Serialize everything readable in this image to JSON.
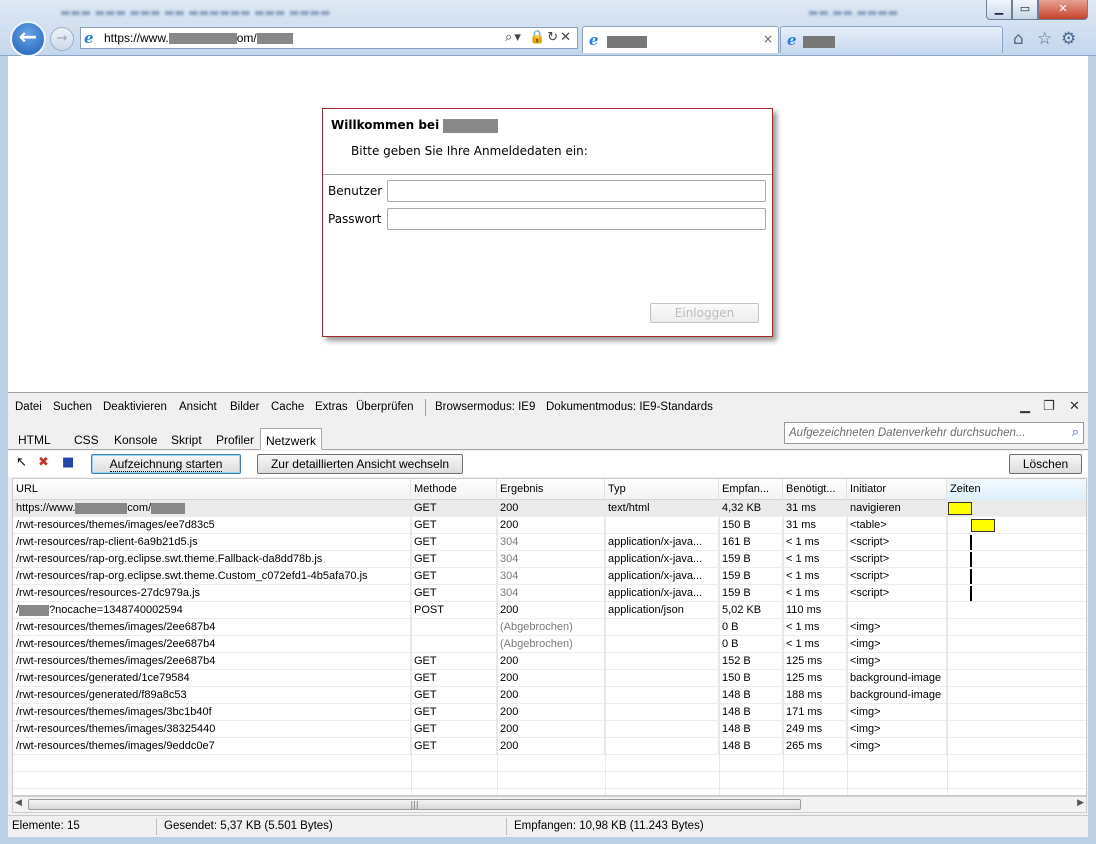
{
  "browser": {
    "url_prefix": "https://www.",
    "url_mid": "om/",
    "tab1_close": "×",
    "window_controls": {
      "minimize": "▁",
      "maximize": "▭",
      "close": "✕"
    }
  },
  "login": {
    "title": "Willkommen bei",
    "subtitle": "Bitte geben Sie Ihre Anmeldedaten ein:",
    "user_label": "Benutzer",
    "password_label": "Passwort",
    "user_value": "",
    "password_value": "",
    "submit_label": "Einloggen"
  },
  "devtools": {
    "menu": [
      "Datei",
      "Suchen",
      "Deaktivieren",
      "Ansicht",
      "Bilder",
      "Cache",
      "Extras",
      "Überprüfen"
    ],
    "browser_mode": "Browsermodus: IE9",
    "document_mode": "Dokumentmodus: IE9-Standards",
    "tabs": [
      "HTML",
      "CSS",
      "Konsole",
      "Skript",
      "Profiler",
      "Netzwerk"
    ],
    "active_tab": "Netzwerk",
    "search_placeholder": "Aufgezeichneten Datenverkehr durchsuchen...",
    "buttons": {
      "record": "Aufzeichnung starten",
      "detail": "Zur detaillierten Ansicht wechseln",
      "clear": "Löschen"
    },
    "columns": [
      "URL",
      "Methode",
      "Ergebnis",
      "Typ",
      "Empfan...",
      "Benötigt...",
      "Initiator",
      "Zeiten"
    ],
    "rows": [
      {
        "url_pre": "https://www.",
        "url_post": "com/",
        "redacted": true,
        "method": "GET",
        "result": "200",
        "type": "text/html",
        "received": "4,32 KB",
        "time": "31 ms",
        "initiator": "navigieren",
        "timing": "bar0",
        "selected": true
      },
      {
        "url": "/rwt-resources/themes/images/ee7d83c5",
        "method": "GET",
        "result": "200",
        "type": "",
        "received": "150 B",
        "time": "31 ms",
        "initiator": "<table>",
        "timing": "bar1"
      },
      {
        "url": "/rwt-resources/rap-client-6a9b21d5.js",
        "method": "GET",
        "result": "304",
        "type": "application/x-java...",
        "received": "161 B",
        "time": "< 1 ms",
        "initiator": "<script>",
        "timing": "tick"
      },
      {
        "url": "/rwt-resources/rap-org.eclipse.swt.theme.Fallback-da8dd78b.js",
        "method": "GET",
        "result": "304",
        "type": "application/x-java...",
        "received": "159 B",
        "time": "< 1 ms",
        "initiator": "<script>",
        "timing": "tick"
      },
      {
        "url": "/rwt-resources/rap-org.eclipse.swt.theme.Custom_c072efd1-4b5afa70.js",
        "method": "GET",
        "result": "304",
        "type": "application/x-java...",
        "received": "159 B",
        "time": "< 1 ms",
        "initiator": "<script>",
        "timing": "tick"
      },
      {
        "url": "/rwt-resources/resources-27dc979a.js",
        "method": "GET",
        "result": "304",
        "type": "application/x-java...",
        "received": "159 B",
        "time": "< 1 ms",
        "initiator": "<script>",
        "timing": "tick"
      },
      {
        "url_pre": "/",
        "url_post": "?nocache=1348740002594",
        "redacted": true,
        "method": "POST",
        "result": "200",
        "type": "application/json",
        "received": "5,02 KB",
        "time": "110 ms",
        "initiator": "",
        "timing": ""
      },
      {
        "url": "/rwt-resources/themes/images/2ee687b4",
        "method": "",
        "result": "(Abgebrochen)",
        "type": "",
        "received": "0 B",
        "time": "< 1 ms",
        "initiator": "<img>",
        "timing": ""
      },
      {
        "url": "/rwt-resources/themes/images/2ee687b4",
        "method": "",
        "result": "(Abgebrochen)",
        "type": "",
        "received": "0 B",
        "time": "< 1 ms",
        "initiator": "<img>",
        "timing": ""
      },
      {
        "url": "/rwt-resources/themes/images/2ee687b4",
        "method": "GET",
        "result": "200",
        "type": "",
        "received": "152 B",
        "time": "125 ms",
        "initiator": "<img>",
        "timing": ""
      },
      {
        "url": "/rwt-resources/generated/1ce79584",
        "method": "GET",
        "result": "200",
        "type": "",
        "received": "150 B",
        "time": "125 ms",
        "initiator": "background-image",
        "timing": ""
      },
      {
        "url": "/rwt-resources/generated/f89a8c53",
        "method": "GET",
        "result": "200",
        "type": "",
        "received": "148 B",
        "time": "188 ms",
        "initiator": "background-image",
        "timing": ""
      },
      {
        "url": "/rwt-resources/themes/images/3bc1b40f",
        "method": "GET",
        "result": "200",
        "type": "",
        "received": "148 B",
        "time": "171 ms",
        "initiator": "<img>",
        "timing": ""
      },
      {
        "url": "/rwt-resources/themes/images/38325440",
        "method": "GET",
        "result": "200",
        "type": "",
        "received": "148 B",
        "time": "249 ms",
        "initiator": "<img>",
        "timing": ""
      },
      {
        "url": "/rwt-resources/themes/images/9eddc0e7",
        "method": "GET",
        "result": "200",
        "type": "",
        "received": "148 B",
        "time": "265 ms",
        "initiator": "<img>",
        "timing": ""
      }
    ],
    "status": {
      "elements": "Elemente: 15",
      "sent": "Gesendet: 5,37 KB (5.501 Bytes)",
      "received": "Empfangen: 10,98 KB (11.243 Bytes)"
    }
  },
  "icons": {
    "back": "back-arrow-icon",
    "forward": "forward-arrow-icon",
    "ie": "internet-explorer-icon",
    "home": "home-icon",
    "favorites": "star-icon",
    "tools": "gear-icon",
    "select": "pointer-icon",
    "clear_cache": "delete-icon",
    "save": "save-icon",
    "search": "search-icon"
  },
  "colors": {
    "timing_bar": "#ffff00",
    "dialog_border": "#a02b2b",
    "chrome": "#c4d6ec"
  }
}
